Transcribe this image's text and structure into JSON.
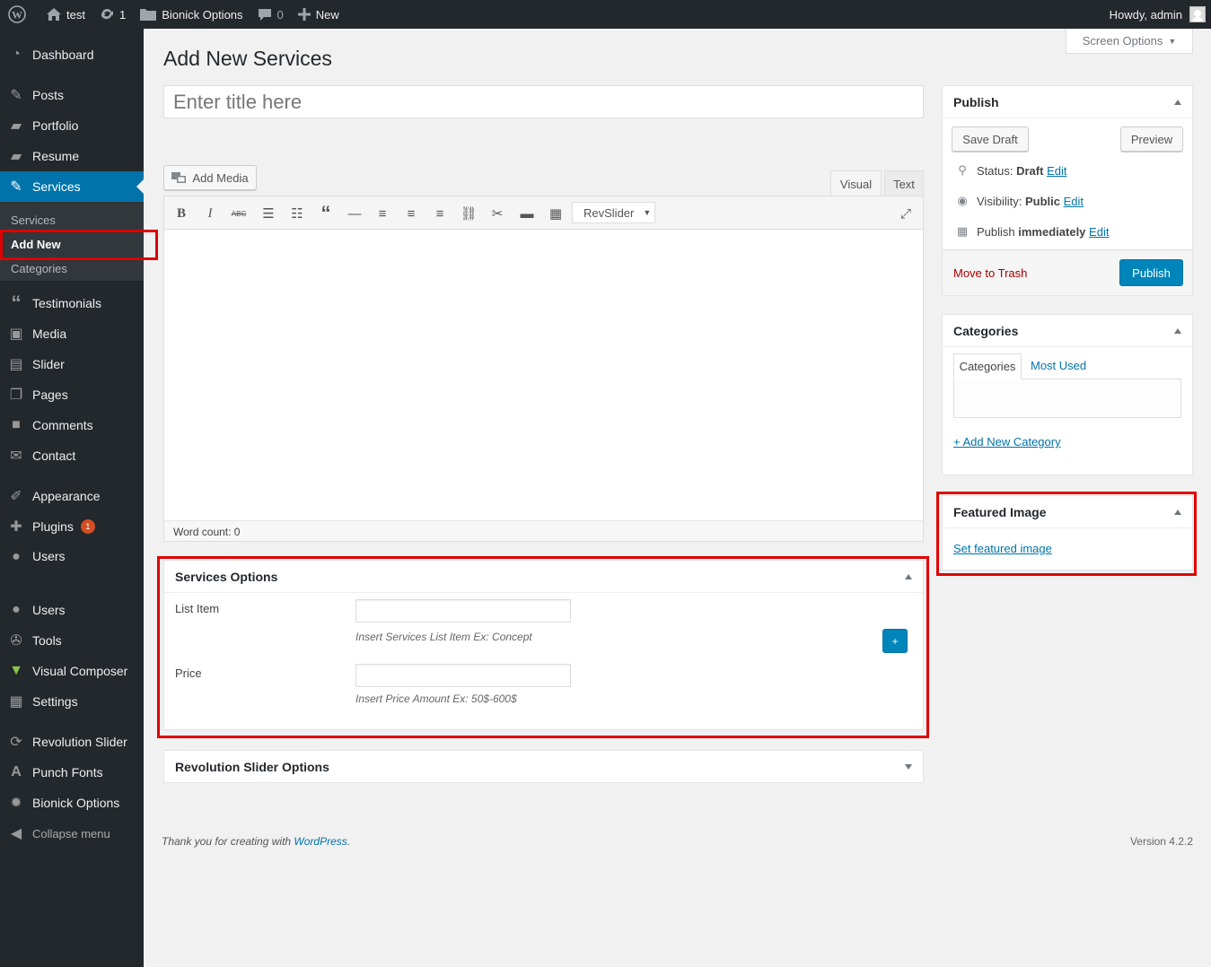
{
  "adminbar": {
    "site_name": "test",
    "updates_count": "1",
    "bionick": "Bionick Options",
    "comments_count": "0",
    "new_label": "New",
    "howdy": "Howdy, admin"
  },
  "sidebar": {
    "items": {
      "dashboard": "Dashboard",
      "posts": "Posts",
      "portfolio": "Portfolio",
      "resume": "Resume",
      "services": "Services",
      "testimonials": "Testimonials",
      "media": "Media",
      "slider": "Slider",
      "pages": "Pages",
      "comments": "Comments",
      "contact": "Contact",
      "appearance": "Appearance",
      "plugins": "Plugins",
      "plugins_badge": "1",
      "users": "Users",
      "users2": "Users",
      "tools": "Tools",
      "visual_composer": "Visual Composer",
      "settings": "Settings",
      "revolution_slider": "Revolution Slider",
      "punch_fonts": "Punch Fonts",
      "bionick_options": "Bionick Options",
      "collapse": "Collapse menu"
    },
    "submenu": {
      "services": "Services",
      "add_new": "Add New",
      "categories": "Categories"
    }
  },
  "main": {
    "screen_options": "Screen Options",
    "page_title": "Add New Services",
    "title_placeholder": "Enter title here",
    "add_media": "Add Media",
    "tab_visual": "Visual",
    "tab_text": "Text",
    "revslider": "RevSlider",
    "word_count": "Word count: 0"
  },
  "services_options": {
    "title": "Services Options",
    "list_item_label": "List Item",
    "list_item_desc": "Insert Services List Item Ex: Concept",
    "add_button": "+",
    "price_label": "Price",
    "price_desc": "Insert Price Amount Ex: 50$-600$"
  },
  "revslider_options": {
    "title": "Revolution Slider Options"
  },
  "publish": {
    "title": "Publish",
    "save_draft": "Save Draft",
    "preview": "Preview",
    "status_label": "Status: ",
    "status_value": "Draft",
    "visibility_label": "Visibility: ",
    "visibility_value": "Public",
    "publish_label": "Publish ",
    "publish_value": "immediately",
    "edit": "Edit",
    "move_to_trash": "Move to Trash",
    "publish_button": "Publish"
  },
  "categories": {
    "title": "Categories",
    "tab_all": "Categories",
    "tab_most_used": "Most Used",
    "add_new": "+ Add New Category"
  },
  "featured_image": {
    "title": "Featured Image",
    "set_link": "Set featured image"
  },
  "footer": {
    "thanks": "Thank you for creating with ",
    "wordpress": "WordPress",
    "period": ".",
    "version": "Version 4.2.2"
  },
  "colors": {
    "admin_dark": "#23282d",
    "accent_blue": "#0073aa",
    "publish_blue": "#0085ba",
    "highlight_red": "#e00000",
    "trash_red": "#a00"
  }
}
